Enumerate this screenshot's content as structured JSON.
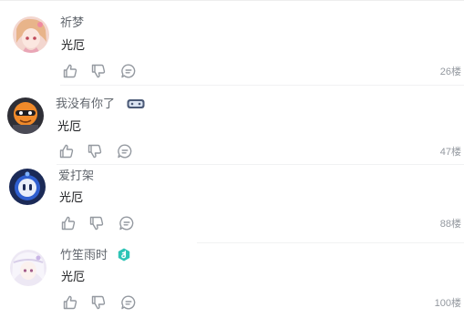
{
  "comments": [
    {
      "username": "祈梦",
      "text": "光厄",
      "floor": "26楼",
      "has_badge": false
    },
    {
      "username": "我没有你了",
      "text": "光厄",
      "floor": "47楼",
      "has_badge": true
    },
    {
      "username": "爱打架",
      "text": "光厄",
      "floor": "88楼",
      "has_badge": false
    },
    {
      "username": "竹笙雨时",
      "text": "光厄",
      "floor": "100楼",
      "has_badge": true
    }
  ],
  "icons": {
    "like": "thumbs-up-icon",
    "dislike": "thumbs-down-icon",
    "reply": "reply-bubble-icon",
    "badge_1": "game-controller-badge-icon",
    "badge_2": "music-note-badge-icon"
  },
  "colors": {
    "username": "#61666d",
    "text": "#18191c",
    "floor": "#9499a0",
    "icon": "#9499a0",
    "music_badge": "#2ec4b6"
  }
}
